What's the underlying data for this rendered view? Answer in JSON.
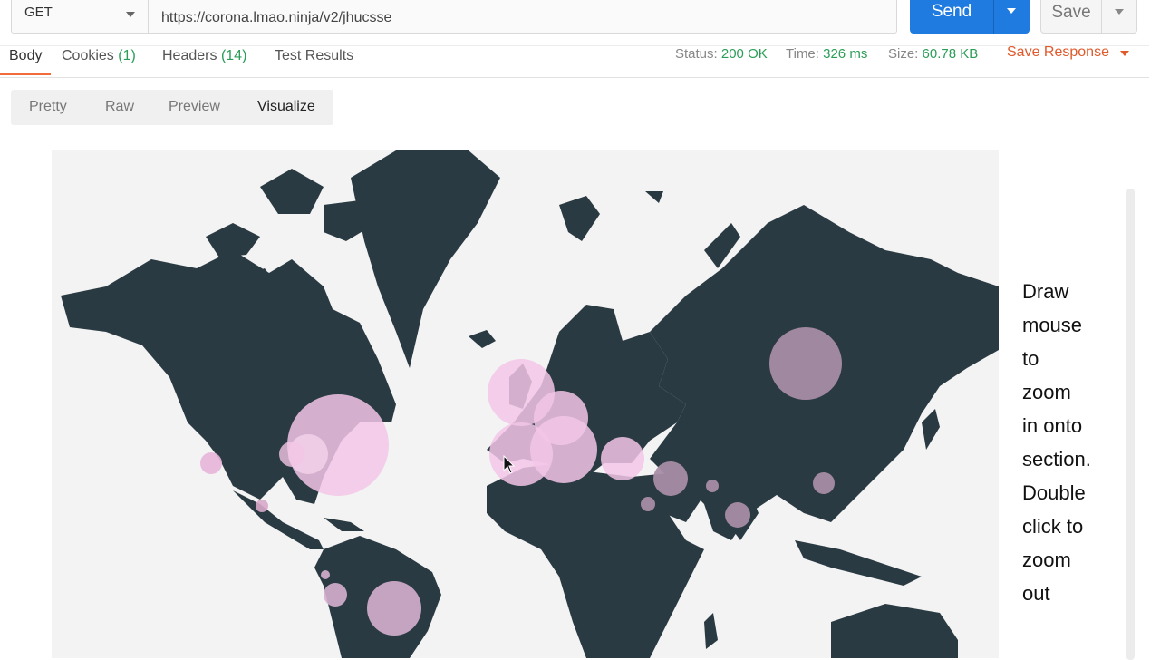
{
  "request": {
    "method": "GET",
    "url": "https://corona.lmao.ninja/v2/jhucsse",
    "send_label": "Send",
    "save_label": "Save"
  },
  "response_tabs": [
    {
      "label": "Body",
      "count": ""
    },
    {
      "label": "Cookies",
      "count": "(1)"
    },
    {
      "label": "Headers",
      "count": "(14)"
    },
    {
      "label": "Test Results",
      "count": ""
    }
  ],
  "response_meta": {
    "status_label": "Status:",
    "status": "200 OK",
    "time_label": "Time:",
    "time": "326 ms",
    "size_label": "Size:",
    "size": "60.78 KB",
    "save_response": "Save Response"
  },
  "view_tabs": [
    "Pretty",
    "Raw",
    "Preview",
    "Visualize"
  ],
  "active_view": "Visualize",
  "visualization": {
    "instructions": [
      "Draw",
      "mouse",
      "to",
      "zoom",
      "in onto",
      "section.",
      "Double",
      "click to",
      "zoom",
      "out"
    ]
  },
  "colors": {
    "accent": "#1f7be0",
    "success": "#2b9d57",
    "active_tab": "#f26b3a",
    "save_response": "#e05a2b",
    "land": "#2a3a42",
    "ocean": "#f3f3f3",
    "bubble": "#f2c6e6",
    "bubble_muted": "#a88ca6"
  },
  "icons": {
    "method_caret": "chevron-down-icon",
    "send_caret": "chevron-down-icon",
    "save_caret": "chevron-down-icon",
    "pointer": "mouse-pointer-icon"
  }
}
